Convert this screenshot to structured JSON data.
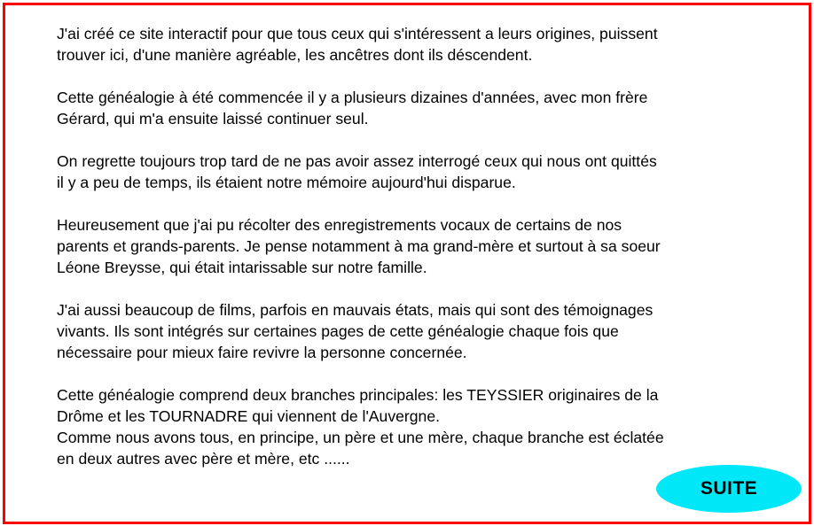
{
  "colors": {
    "frame_border": "#ff0000",
    "button_fill": "#00e8f8",
    "text": "#000000"
  },
  "content": {
    "paragraphs": [
      "J'ai créé ce site interactif pour que tous ceux qui s'intéressent a leurs origines, puissent\ntrouver ici, d'une manière agréable, les ancêtres dont ils déscendent.",
      "Cette généalogie à été commencée il y a plusieurs dizaines d'années, avec mon frère\nGérard, qui m'a ensuite laissé continuer seul.",
      "On regrette toujours trop tard de ne pas avoir assez interrogé ceux qui nous ont quittés\nil y a peu de temps, ils étaient notre mémoire aujourd'hui disparue.",
      "Heureusement que j'ai pu récolter des enregistrements vocaux de certains de nos\nparents et grands-parents.  Je pense notamment à ma grand-mère et surtout à sa soeur\nLéone Breysse, qui était intarissable sur notre famille.",
      "J'ai aussi beaucoup de films, parfois en mauvais états, mais qui sont des témoignages\nvivants. Ils sont intégrés sur certaines pages de cette généalogie chaque fois que\nnécessaire pour mieux faire revivre la personne concernée.",
      "Cette généalogie comprend deux branches principales: les TEYSSIER  originaires de la\nDrôme et les TOURNADRE qui viennent de l'Auvergne.\nComme nous avons tous, en principe, un père et une mère, chaque branche est éclatée\nen deux autres avec père et mère, etc ......"
    ]
  },
  "navigation": {
    "next_label": "SUITE"
  }
}
